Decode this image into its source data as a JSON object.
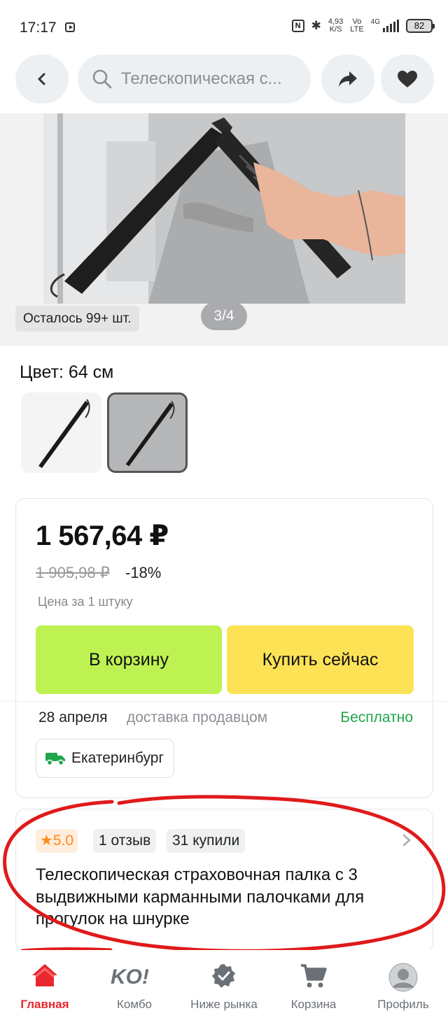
{
  "status_bar": {
    "time": "17:17",
    "speed_value": "4,93",
    "speed_unit": "K/S",
    "volte_top": "Vo",
    "volte_bottom": "LTE",
    "network": "4G",
    "battery": "82"
  },
  "header": {
    "search_text": "Телескопическая с..."
  },
  "gallery": {
    "stock_label": "Осталось 99+ шт.",
    "pager": "3/4"
  },
  "color": {
    "label": "Цвет: 64 см",
    "selected_index": 1
  },
  "price": {
    "current": "1 567,64 ₽",
    "old": "1 905,98 ₽",
    "discount": "-18%",
    "per_unit": "Цена за 1 штуку",
    "add_to_cart": "В корзину",
    "buy_now": "Купить сейчас"
  },
  "delivery": {
    "date": "28 апреля",
    "by": "доставка продавцом",
    "cost": "Бесплатно",
    "city": "Екатеринбург"
  },
  "product": {
    "rating": "5.0",
    "reviews": "1 отзыв",
    "bought": "31 купили",
    "title": "Телескопическая страховочная палка с 3 выдвижными карманными палочками для прогулок на шнурке"
  },
  "tabs": {
    "home": "Главная",
    "kombo": "Комбо",
    "below_market": "Ниже рынка",
    "cart": "Корзина",
    "profile": "Профиль"
  },
  "colors": {
    "accent_red": "#e8282e",
    "cart_green": "#bdf252",
    "buy_yellow": "#fde256",
    "free_green": "#1fa64a"
  }
}
